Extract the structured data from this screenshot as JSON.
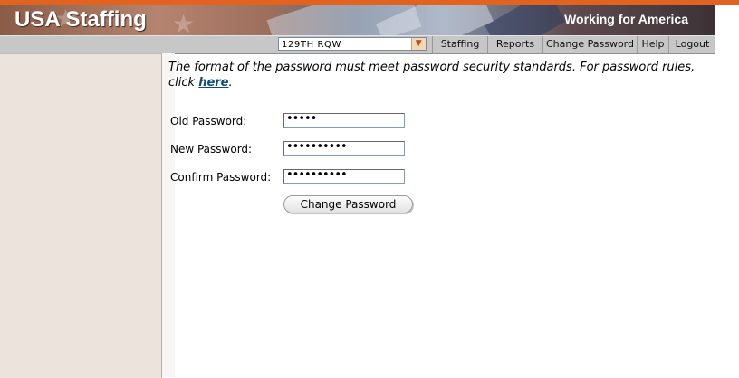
{
  "header": {
    "brand": "USA Staffing",
    "slogan": "Working for America"
  },
  "navbar": {
    "org_selected": "129TH RQW",
    "links": [
      "Staffing",
      "Reports",
      "Change Password",
      "Help",
      "Logout"
    ]
  },
  "form": {
    "info_text": "The format of the password must meet password security standards. For password rules, click ",
    "info_link": "here",
    "info_end": ".",
    "fields": [
      {
        "label": "Old Password:",
        "value": "•••••"
      },
      {
        "label": "New Password:",
        "value": "••••••••••"
      },
      {
        "label": "Confirm Password:",
        "value": "••••••••••"
      }
    ],
    "submit_label": "Change Password"
  },
  "colors": {
    "accent_stripe": "#e2631f",
    "sidebar_bg": "#ece3dd",
    "navbar_bg": "#c7c7c7",
    "link": "#0e4c7a"
  }
}
